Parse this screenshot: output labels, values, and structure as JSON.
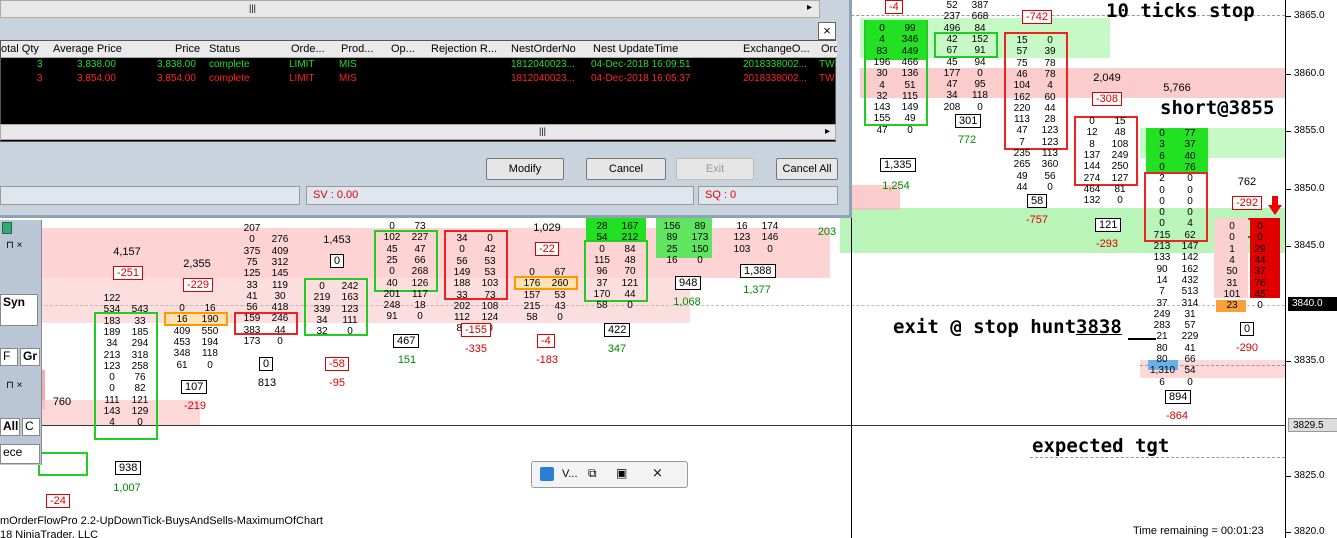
{
  "order_window": {
    "columns": [
      "otal Qty",
      "Average Price",
      "Price",
      "Status",
      "Orde...",
      "Prod...",
      "Op...",
      "Rejection R...",
      "NestOrderNo",
      "Nest UpdateTime",
      "ExchangeO...",
      "Ord"
    ],
    "rows": [
      {
        "qty": "3",
        "avg": "3,838.00",
        "price": "3,838.00",
        "status": "complete",
        "order": "LIMIT",
        "prod": "MIS",
        "nest": "1812040023...",
        "time": "04-Dec-2018 16:09:51",
        "exch": "2018338002...",
        "ord": "TW"
      },
      {
        "qty": "3",
        "avg": "3,854.00",
        "price": "3,854.00",
        "status": "complete",
        "order": "LIMIT",
        "prod": "MIS",
        "nest": "1812040023...",
        "time": "04-Dec-2018 16:05:37",
        "exch": "2018338002...",
        "ord": "TW"
      }
    ],
    "buttons": {
      "modify": "Modify",
      "cancel": "Cancel",
      "exit": "Exit",
      "cancel_all": "Cancel All"
    },
    "sv": "SV : 0.00",
    "sq": "SQ : 0",
    "close": "×"
  },
  "left_panel": {
    "syn": "Syn",
    "f": "F",
    "gr": "Gr",
    "all": "All",
    "c": "C",
    "rece": "ece"
  },
  "mini_window": {
    "label": "V..."
  },
  "annotations": {
    "stop": "10 ticks stop",
    "short": "short@3855",
    "exit": "exit @ stop hunt",
    "exit_price": "3838",
    "target": "expected tgt"
  },
  "footer": {
    "indicator": "mOrderFlowPro 2.2-UpDownTick-BuysAndSells-MaximumOfChart",
    "copyright": "18 NinjaTrader, LLC",
    "time_remaining": "Time remaining = 00:01:23"
  },
  "price_axis": {
    "ticks": [
      "3865.0",
      "3860.0",
      "3855.0",
      "3850.0",
      "3845.0",
      "3840.0",
      "3835.0",
      "3829.5",
      "3825.0",
      "3820.0"
    ],
    "current": "3840.0",
    "marker": "3829.5"
  },
  "chart_data": {
    "type": "table",
    "bars": [
      {
        "vol": "760",
        "delta": "-24",
        "total": "1,007",
        "vbox": "938"
      },
      {
        "vol": "4,157",
        "delta": "-251",
        "total": "",
        "vbox": ""
      },
      {
        "vol": "2,355",
        "delta": "-229",
        "total": "-219",
        "vbox": "107"
      },
      {
        "vol": "",
        "delta": "",
        "total": "813",
        "vbox": "0"
      },
      {
        "vol": "1,453",
        "delta": "0",
        "total": "-95",
        "vbox": "-58"
      },
      {
        "vol": "",
        "delta": "",
        "total": "151",
        "vbox": "467"
      },
      {
        "vol": "",
        "delta": "",
        "total": "-335",
        "vbox": "-155"
      },
      {
        "vol": "1,029",
        "delta": "-22",
        "total": "-183",
        "vbox": "-4"
      },
      {
        "vol": "",
        "delta": "",
        "total": "347",
        "vbox": "422"
      },
      {
        "vol": "",
        "delta": "",
        "total": "1,068",
        "vbox": "948"
      },
      {
        "vol": "",
        "delta": "",
        "total": "1,377",
        "vbox": "1,388"
      },
      {
        "vol": "",
        "delta": "",
        "total": "203",
        "vbox": ""
      },
      {
        "vol": "",
        "delta": "",
        "total": "1,254",
        "vbox": "1,335"
      },
      {
        "vol": "",
        "delta": "-4",
        "total": "772",
        "vbox": "301"
      },
      {
        "vol": "",
        "delta": "-742",
        "total": "-757",
        "vbox": "58"
      },
      {
        "vol": "2,049",
        "delta": "-308",
        "total": "-293",
        "vbox": "121"
      },
      {
        "vol": "5,766",
        "delta": "",
        "total": "-864",
        "vbox": "894"
      },
      {
        "vol": "762",
        "delta": "-292",
        "total": "-290",
        "vbox": "0"
      }
    ],
    "cells": {
      "b1": [
        [
          "122",
          ""
        ],
        [
          "534",
          "543"
        ],
        [
          "183",
          "33"
        ],
        [
          "189",
          "185"
        ],
        [
          "34",
          "294"
        ],
        [
          "213",
          "318"
        ],
        [
          "123",
          "258"
        ],
        [
          "0",
          "76"
        ],
        [
          "0",
          "82"
        ],
        [
          "111",
          "121"
        ],
        [
          "143",
          "129"
        ],
        [
          "4",
          "0"
        ]
      ],
      "b2": [
        [
          "0",
          "16"
        ],
        [
          "16",
          "190"
        ],
        [
          "409",
          "550"
        ],
        [
          "453",
          "194"
        ],
        [
          "348",
          "118"
        ],
        [
          "61",
          "0"
        ]
      ],
      "b3": [
        [
          "207",
          ""
        ],
        [
          "0",
          "276"
        ],
        [
          "375",
          "409"
        ],
        [
          "75",
          "312"
        ],
        [
          "125",
          "145"
        ],
        [
          "33",
          "119"
        ],
        [
          "41",
          "30"
        ],
        [
          "56",
          "418"
        ],
        [
          "159",
          "246"
        ],
        [
          "383",
          "44"
        ],
        [
          "173",
          "0"
        ]
      ],
      "b4": [
        [
          "0",
          "242"
        ],
        [
          "219",
          "163"
        ],
        [
          "339",
          "123"
        ],
        [
          "34",
          "111"
        ],
        [
          "32",
          "0"
        ]
      ],
      "b5": [
        [
          "0",
          "73"
        ],
        [
          "102",
          "227"
        ],
        [
          "45",
          "47"
        ],
        [
          "25",
          "66"
        ],
        [
          "0",
          "268"
        ],
        [
          "40",
          "126"
        ],
        [
          "201",
          "117"
        ],
        [
          "248",
          "18"
        ],
        [
          "91",
          "0"
        ]
      ],
      "b6": [
        [
          "34",
          "0"
        ],
        [
          "0",
          "42"
        ],
        [
          "56",
          "53"
        ],
        [
          "149",
          "53"
        ],
        [
          "188",
          "103"
        ],
        [
          "33",
          "73"
        ],
        [
          "202",
          "108"
        ],
        [
          "112",
          "124"
        ],
        [
          "80",
          "0"
        ]
      ],
      "b7": [
        [
          "0",
          "67"
        ],
        [
          "176",
          "260"
        ],
        [
          "157",
          "53"
        ],
        [
          "215",
          "43"
        ],
        [
          "58",
          "0"
        ]
      ],
      "b8": [
        [
          "28",
          "167"
        ],
        [
          "54",
          "212"
        ],
        [
          "0",
          "84"
        ],
        [
          "115",
          "48"
        ],
        [
          "96",
          "70"
        ],
        [
          "37",
          "121"
        ],
        [
          "170",
          "44"
        ],
        [
          "58",
          "0"
        ]
      ],
      "b9": [
        [
          "156",
          "89"
        ],
        [
          "89",
          "173"
        ],
        [
          "25",
          "150"
        ],
        [
          "16",
          "0"
        ]
      ],
      "b10": [
        [
          "16",
          "174"
        ],
        [
          "123",
          "146"
        ],
        [
          "103",
          "0"
        ]
      ],
      "b12": [
        [
          "0",
          "99"
        ],
        [
          "4",
          "346"
        ],
        [
          "83",
          "449"
        ],
        [
          "196",
          "466"
        ],
        [
          "30",
          "136"
        ],
        [
          "4",
          "51"
        ],
        [
          "32",
          "115"
        ],
        [
          "143",
          "149"
        ],
        [
          "155",
          "49"
        ],
        [
          "47",
          "0"
        ]
      ],
      "b13": [
        [
          "52",
          "387"
        ],
        [
          "237",
          "668"
        ],
        [
          "496",
          "84"
        ],
        [
          "42",
          "152"
        ],
        [
          "67",
          "91"
        ],
        [
          "45",
          "94"
        ],
        [
          "177",
          "0"
        ],
        [
          "47",
          "95"
        ],
        [
          "34",
          "118"
        ],
        [
          "208",
          "0"
        ]
      ],
      "b14": [
        [
          "15",
          "0"
        ],
        [
          "57",
          "39"
        ],
        [
          "75",
          "78"
        ],
        [
          "46",
          "78"
        ],
        [
          "104",
          "4"
        ],
        [
          "162",
          "60"
        ],
        [
          "220",
          "44"
        ],
        [
          "113",
          "28"
        ],
        [
          "47",
          "123"
        ],
        [
          "7",
          "123"
        ],
        [
          "235",
          "113"
        ],
        [
          "265",
          "360"
        ],
        [
          "49",
          "56"
        ],
        [
          "44",
          "0"
        ]
      ],
      "b15": [
        [
          "0",
          "15"
        ],
        [
          "12",
          "48"
        ],
        [
          "8",
          "108"
        ],
        [
          "137",
          "249"
        ],
        [
          "144",
          "250"
        ],
        [
          "274",
          "127"
        ],
        [
          "464",
          "81"
        ],
        [
          "132",
          "0"
        ]
      ],
      "b16": [
        [
          "0",
          "77"
        ],
        [
          "3",
          "37"
        ],
        [
          "6",
          "40"
        ],
        [
          "0",
          "76"
        ],
        [
          "2",
          "0"
        ],
        [
          "0",
          "0"
        ],
        [
          "0",
          "0"
        ],
        [
          "0",
          "0"
        ],
        [
          "0",
          "4"
        ],
        [
          "715",
          "62"
        ],
        [
          "213",
          "147"
        ],
        [
          "133",
          "142"
        ],
        [
          "90",
          "162"
        ],
        [
          "14",
          "432"
        ],
        [
          "7",
          "513"
        ],
        [
          "37",
          "314"
        ],
        [
          "249",
          "31"
        ],
        [
          "283",
          "57"
        ],
        [
          "21",
          "229"
        ],
        [
          "80",
          "41"
        ],
        [
          "80",
          "66"
        ],
        [
          "1,310",
          "54"
        ],
        [
          "6",
          "0"
        ]
      ],
      "b17": [
        [
          "0",
          "0"
        ],
        [
          "0",
          "0"
        ],
        [
          "1",
          "29"
        ],
        [
          "4",
          "44"
        ],
        [
          "50",
          "37"
        ],
        [
          "31",
          "76"
        ],
        [
          "101",
          "45"
        ],
        [
          "23",
          "0"
        ]
      ]
    }
  }
}
